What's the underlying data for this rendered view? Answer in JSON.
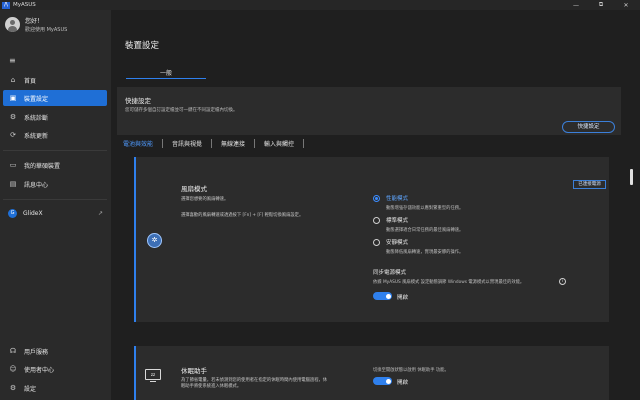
{
  "titlebar": {
    "logo": "/\\",
    "title": "MyASUS",
    "minimize": "—",
    "restore": "⧉",
    "close": "✕"
  },
  "sidebar": {
    "greeting": "您好！",
    "welcome": "歡迎使用 MyASUS",
    "menu_icon": "≡",
    "items": [
      {
        "label": "首頁",
        "icon": "⌂"
      },
      {
        "label": "裝置設定",
        "icon": "▣"
      },
      {
        "label": "系統診斷",
        "icon": "⚙"
      },
      {
        "label": "系統更新",
        "icon": "⟳"
      },
      {
        "label": "我的華碩裝置",
        "icon": "▭"
      },
      {
        "label": "訊息中心",
        "icon": "▤"
      },
      {
        "label": "GlideX",
        "icon": "G",
        "external": "↗"
      },
      {
        "label": "用戶服務",
        "icon": "☊"
      },
      {
        "label": "使用者中心",
        "icon": "☺"
      },
      {
        "label": "設定",
        "icon": "⚙"
      }
    ]
  },
  "main": {
    "page_title": "裝置設定",
    "tab": "一般",
    "quick": {
      "title": "快捷設定",
      "desc": "您可儲存多個自訂設定檔並可一鍵在不同設定檔內切換。",
      "button": "快捷設定"
    },
    "subtabs": [
      "電池與效能",
      "音訊與視覺",
      "無線連接",
      "輸入與觸控"
    ],
    "fan": {
      "title": "風扇模式",
      "desc1": "選擇您想要的風扇轉速。",
      "desc2": "選擇喜歡的風扇轉速或透過按下 [Fn] + [F] 輕鬆切換風扇設定。",
      "badge": "已連接電源",
      "options": [
        {
          "label": "性能模式",
          "desc": "動態增強存儲效能以應對繁重型的任務。"
        },
        {
          "label": "標準模式",
          "desc": "動態選擇適合日常任務的最佳風扇轉速。"
        },
        {
          "label": "安靜模式",
          "desc": "動態降低風扇轉速，實現最安靜的操作。"
        }
      ],
      "sync_title": "同步電源模式",
      "sync_desc": "依據 MyASUS 風扇模式 設定動態調節 Windows 電源模式以實現最佳的效能。",
      "sync_toggle": "開啟"
    },
    "sleep": {
      "title": "休眠助手",
      "desc": "為了節省電量，若未偵測到您的使用者在指定的休眠時間內使用電腦過程，休眠助手將使系統進入休眠模式。",
      "right_desc": "切換至開啟狀態以啟用 休眠助手 功能。",
      "toggle": "開啟"
    }
  }
}
